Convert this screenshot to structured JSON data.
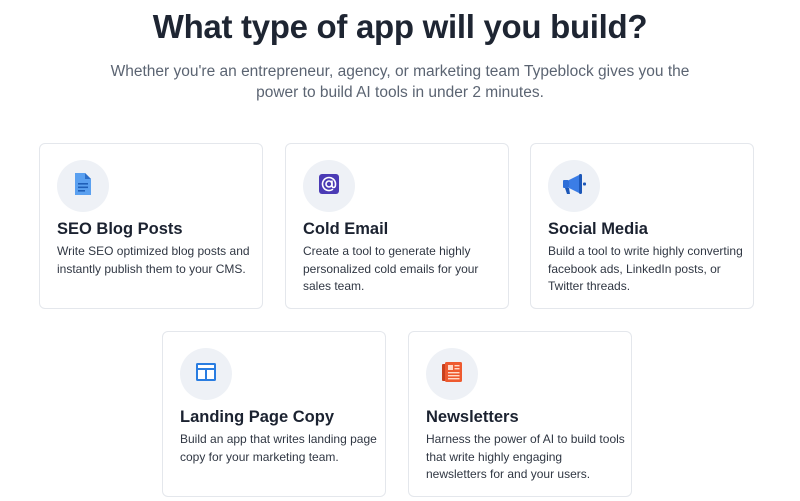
{
  "header": {
    "title": "What type of app will you build?",
    "subtitle_line1": "Whether you're an entrepreneur, agency, or marketing team Typeblock gives you the",
    "subtitle_line2": "power to build AI tools in under 2 minutes."
  },
  "cards": [
    {
      "icon": "document-icon",
      "title": "SEO Blog Posts",
      "description": "Write SEO optimized blog posts and instantly publish them to your CMS."
    },
    {
      "icon": "at-sign-icon",
      "title": "Cold Email",
      "description": "Create a tool to generate highly personalized cold emails for your sales team."
    },
    {
      "icon": "megaphone-icon",
      "title": "Social Media",
      "description": "Build a tool to write highly converting facebook ads, LinkedIn posts, or Twitter threads."
    },
    {
      "icon": "layout-icon",
      "title": "Landing Page Copy",
      "description": "Build an app that writes landing page copy for your marketing team."
    },
    {
      "icon": "newspaper-icon",
      "title": "Newsletters",
      "description": "Harness the power of AI to build tools that write highly engaging newsletters for and your users."
    }
  ],
  "colors": {
    "document": "#4a90e2",
    "at_sign": "#4b3bb5",
    "megaphone": "#2f6fd8",
    "layout": "#2a7de1",
    "newspaper": "#ee5a2f"
  }
}
